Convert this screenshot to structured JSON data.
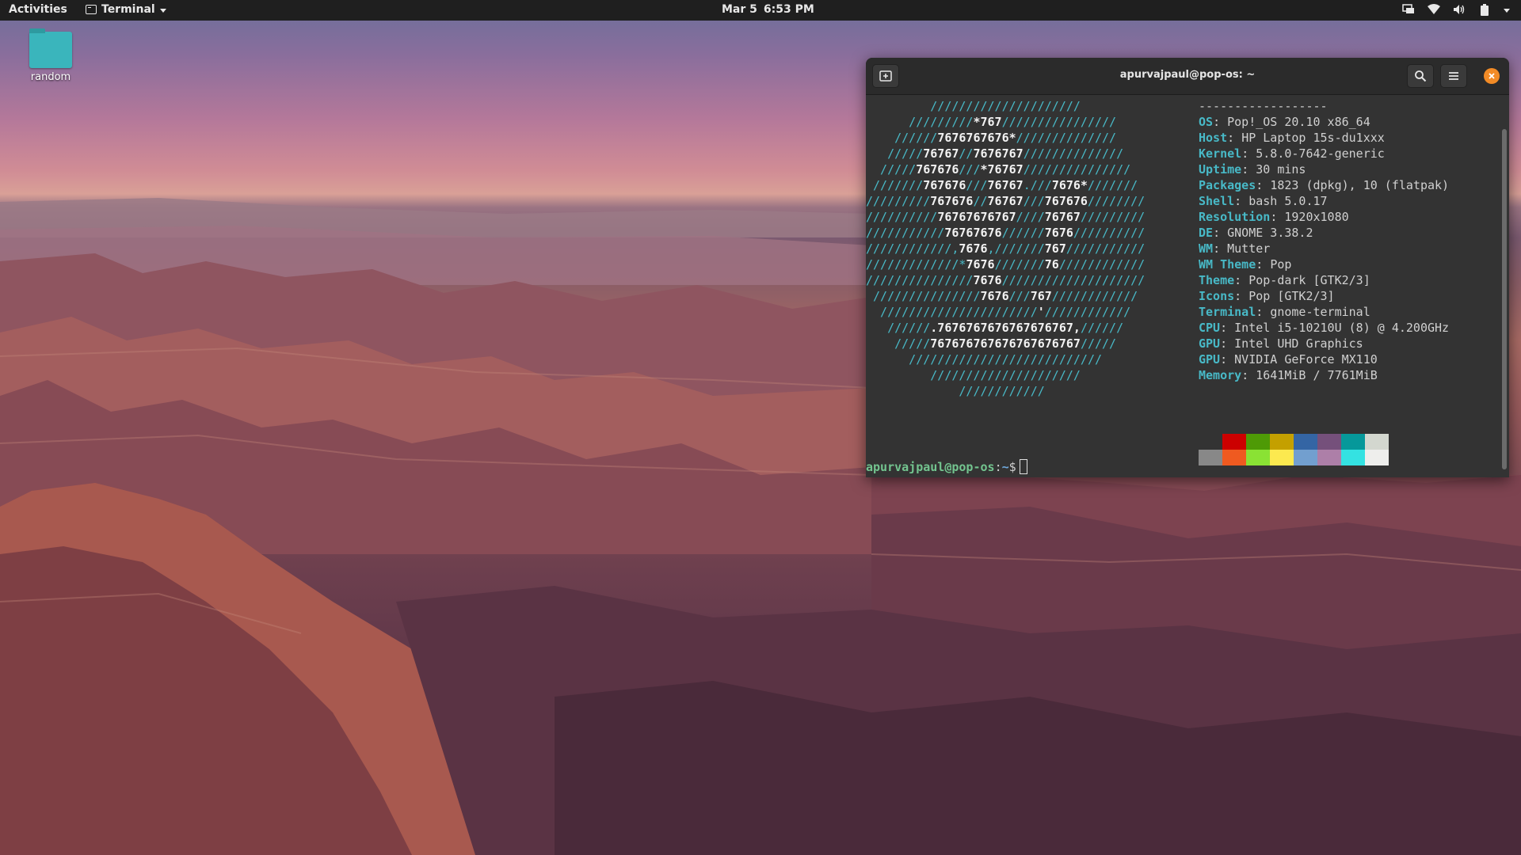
{
  "topbar": {
    "activities": "Activities",
    "app_name": "Terminal",
    "date": "Mar 5",
    "time": "6:53 PM"
  },
  "desktop": {
    "icons": [
      {
        "label": "random",
        "icon": "folder-icon",
        "color": "#3ab5bc"
      }
    ]
  },
  "terminal": {
    "title": "apurvajpaul@pop-os: ~",
    "logo_color": "#48b9c7",
    "info_separator": "------------------",
    "info": [
      {
        "key": "OS",
        "value": "Pop!_OS 20.10 x86_64"
      },
      {
        "key": "Host",
        "value": "HP Laptop 15s-du1xxx"
      },
      {
        "key": "Kernel",
        "value": "5.8.0-7642-generic"
      },
      {
        "key": "Uptime",
        "value": "30 mins"
      },
      {
        "key": "Packages",
        "value": "1823 (dpkg), 10 (flatpak)"
      },
      {
        "key": "Shell",
        "value": "bash 5.0.17"
      },
      {
        "key": "Resolution",
        "value": "1920x1080"
      },
      {
        "key": "DE",
        "value": "GNOME 3.38.2"
      },
      {
        "key": "WM",
        "value": "Mutter"
      },
      {
        "key": "WM Theme",
        "value": "Pop"
      },
      {
        "key": "Theme",
        "value": "Pop-dark [GTK2/3]"
      },
      {
        "key": "Icons",
        "value": "Pop [GTK2/3]"
      },
      {
        "key": "Terminal",
        "value": "gnome-terminal"
      },
      {
        "key": "CPU",
        "value": "Intel i5-10210U (8) @ 4.200GHz"
      },
      {
        "key": "GPU",
        "value": "Intel UHD Graphics"
      },
      {
        "key": "GPU",
        "value": "NVIDIA GeForce MX110"
      },
      {
        "key": "Memory",
        "value": "1641MiB / 7761MiB"
      }
    ],
    "palette_top": [
      "#333333",
      "#cc0000",
      "#4e9a06",
      "#c4a000",
      "#3465a4",
      "#75507b",
      "#06989a",
      "#d3d7cf"
    ],
    "palette_bottom": [
      "#888888",
      "#ef5a20",
      "#8ae234",
      "#fce94f",
      "#729fcf",
      "#ad7fa8",
      "#34e2e2",
      "#eeeeec"
    ],
    "prompt_user": "apurvajpaul@pop-os",
    "prompt_path": "~",
    "prompt_symbol": "$"
  }
}
